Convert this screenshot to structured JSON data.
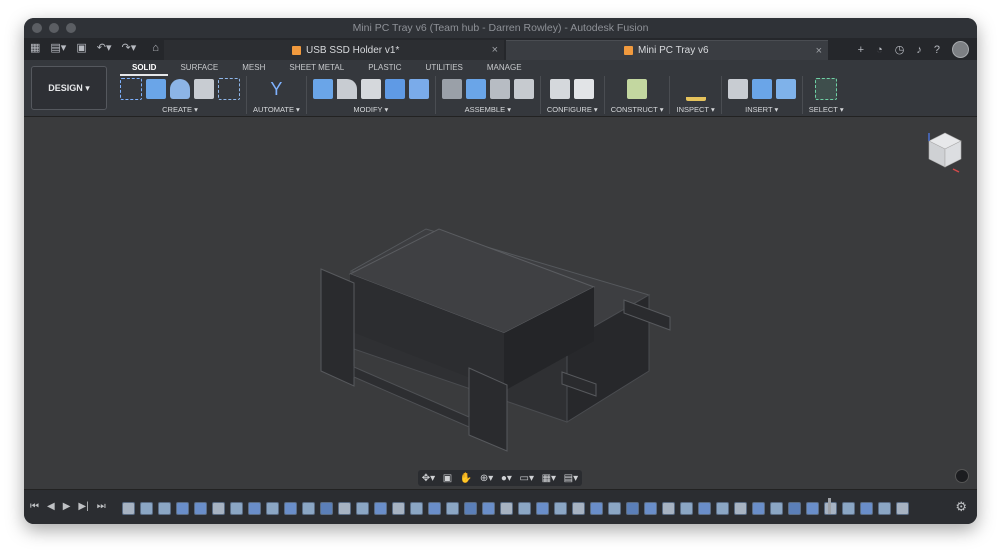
{
  "window": {
    "title": "Mini PC Tray v6 (Team hub - Darren Rowley) - Autodesk Fusion"
  },
  "tabs": [
    {
      "label": "USB SSD Holder v1*",
      "active": false
    },
    {
      "label": "Mini PC Tray v6",
      "active": true
    }
  ],
  "workspace": {
    "label": "DESIGN ▾"
  },
  "ribbon_tabs": [
    "SOLID",
    "SURFACE",
    "MESH",
    "SHEET METAL",
    "PLASTIC",
    "UTILITIES",
    "MANAGE"
  ],
  "groups": [
    {
      "label": "CREATE ▾",
      "icons": [
        "sketch-icon",
        "extrude-icon",
        "revolve-icon",
        "hole-icon",
        "pattern-icon"
      ]
    },
    {
      "label": "AUTOMATE ▾",
      "icons": [
        "automate-icon"
      ]
    },
    {
      "label": "MODIFY ▾",
      "icons": [
        "press-pull-icon",
        "fillet-icon",
        "shell-icon",
        "combine-icon",
        "split-icon"
      ]
    },
    {
      "label": "ASSEMBLE ▾",
      "icons": [
        "joint-icon",
        "new-component-icon",
        "as-built-joint-icon",
        "joint-origin-icon"
      ]
    },
    {
      "label": "CONFIGURE ▾",
      "icons": [
        "configure-icon",
        "table-icon"
      ]
    },
    {
      "label": "CONSTRUCT ▾",
      "icons": [
        "plane-icon"
      ]
    },
    {
      "label": "INSPECT ▾",
      "icons": [
        "measure-icon"
      ]
    },
    {
      "label": "INSERT ▾",
      "icons": [
        "insert-link-icon",
        "insert-text-icon",
        "insert-image-icon"
      ]
    },
    {
      "label": "SELECT ▾",
      "icons": [
        "select-icon"
      ]
    }
  ],
  "colors": {
    "accent_orange": "#f19a3e",
    "viewport_bg": "#3a3b3d",
    "ribbon_bg": "#35383d"
  }
}
